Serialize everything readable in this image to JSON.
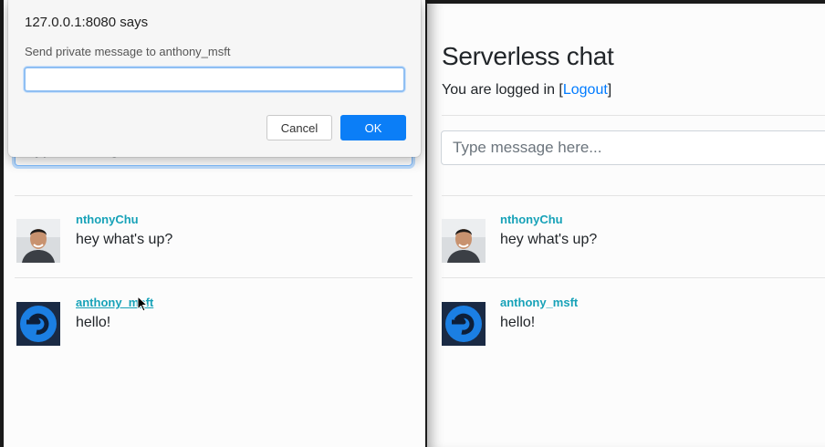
{
  "dialog": {
    "title": "127.0.0.1:8080 says",
    "message": "Send private message to anthony_msft",
    "input_value": "",
    "cancel_label": "Cancel",
    "ok_label": "OK"
  },
  "right": {
    "title": "Serverless chat",
    "login_prefix": "You are logged in ",
    "logout_open": "[",
    "logout_label": "Logout",
    "logout_close": "]",
    "input_placeholder": "Type message here..."
  },
  "messages": [
    {
      "sender": "nthonyChu",
      "text": "hey what's up?",
      "avatar": "person-photo-avatar"
    },
    {
      "sender": "anthony_msft",
      "text": "hello!",
      "avatar": "blue-logo-avatar"
    }
  ],
  "colors": {
    "sender": "#17a2b8",
    "link": "#007bff",
    "ok_button": "#0b7ef7"
  }
}
